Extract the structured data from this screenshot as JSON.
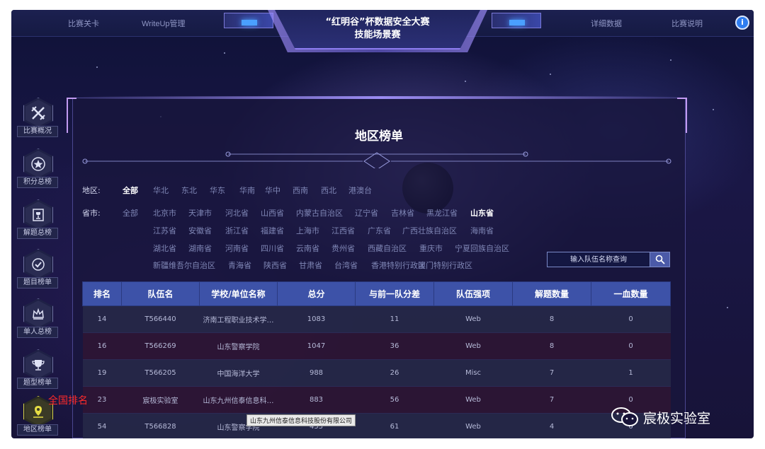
{
  "topbar": {
    "nav_left": [
      "比赛关卡",
      "WriteUp管理"
    ],
    "nav_right": [
      "详细数据",
      "比赛说明"
    ],
    "title_line1": "“红明谷”杯数据安全大赛",
    "title_line2": "技能场景赛",
    "help_icon": "help-icon"
  },
  "sidebar": {
    "items": [
      {
        "label": "比赛概况",
        "icon": "crossed-swords-icon"
      },
      {
        "label": "积分总榜",
        "icon": "star-badge-icon"
      },
      {
        "label": "解题总榜",
        "icon": "trophy-icon"
      },
      {
        "label": "题目榜单",
        "icon": "check-badge-icon"
      },
      {
        "label": "单人总榜",
        "icon": "crown-icon"
      },
      {
        "label": "题型榜单",
        "icon": "cup-icon"
      },
      {
        "label": "地区榜单",
        "icon": "location-pin-icon",
        "active": true
      }
    ]
  },
  "panel": {
    "title": "地区榜单",
    "region_label": "地区:",
    "regions": [
      "全部",
      "华北",
      "东北",
      "华东",
      "华南",
      "华中",
      "西南",
      "西北",
      "港澳台"
    ],
    "selected_region": "全部",
    "province_label": "省市:",
    "provinces": [
      [
        "全部",
        "北京市",
        "天津市",
        "河北省",
        "山西省",
        "内蒙古自治区",
        "辽宁省",
        "吉林省",
        "黑龙江省",
        "山东省"
      ],
      [
        "江苏省",
        "安徽省",
        "浙江省",
        "福建省",
        "上海市",
        "江西省",
        "广东省",
        "广西壮族自治区",
        "海南省"
      ],
      [
        "湖北省",
        "湖南省",
        "河南省",
        "四川省",
        "云南省",
        "贵州省",
        "西藏自治区",
        "重庆市",
        "宁夏回族自治区"
      ],
      [
        "新疆维吾尔自治区",
        "青海省",
        "陕西省",
        "甘肃省",
        "台湾省",
        "香港特别行政区",
        "澳门特别行政区"
      ]
    ],
    "selected_province": "山东省",
    "search": {
      "placeholder": "输入队伍名称查询",
      "icon": "search-icon"
    }
  },
  "table": {
    "headers": [
      "排名",
      "队伍名",
      "学校/单位名称",
      "总分",
      "与前一队分差",
      "队伍强项",
      "解题数量",
      "一血数量"
    ],
    "rows": [
      [
        "14",
        "T566440",
        "济南工程职业技术学…",
        "1083",
        "11",
        "Web",
        "8",
        "0"
      ],
      [
        "16",
        "T566269",
        "山东警察学院",
        "1047",
        "36",
        "Web",
        "8",
        "0"
      ],
      [
        "19",
        "T566205",
        "中国海洋大学",
        "988",
        "26",
        "Misc",
        "7",
        "1"
      ],
      [
        "23",
        "宸极实验室",
        "山东九州信泰信息科…",
        "883",
        "56",
        "Web",
        "7",
        "0"
      ],
      [
        "54",
        "T566828",
        "山东警察学院",
        "453",
        "61",
        "Web",
        "4",
        "0"
      ]
    ]
  },
  "annotation": {
    "national_rank": "全国排名"
  },
  "tooltip": {
    "text": "山东九州信泰信息科技股份有限公司"
  },
  "watermark": {
    "text": "宸极实验室",
    "icon": "wechat-icon"
  },
  "colors": {
    "header_bg": "#3d52a8",
    "accent": "#9b8cf2",
    "annotation": "#ff2a2a",
    "active_sidebar": "#d6d04a"
  }
}
